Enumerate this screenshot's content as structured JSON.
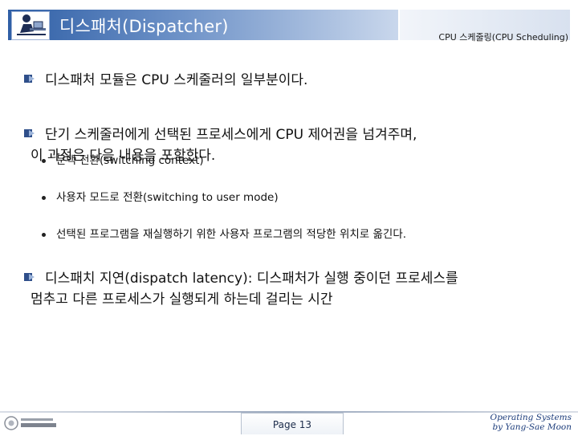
{
  "header": {
    "title": "디스패처(Dispatcher)",
    "subtitle": "CPU 스케줄링(CPU Scheduling)",
    "logo_icon": "person-at-desk-icon"
  },
  "body": {
    "bullets": [
      {
        "lines": [
          "디스패처 모듈은 CPU 스케줄러의 일부분이다."
        ]
      },
      {
        "lines": [
          "단기 스케줄러에게 선택된 프로세스에게 CPU 제어권을 넘겨주며,",
          "이 과정은 다음 내용을 포함한다."
        ]
      },
      {
        "lines": [
          "디스패치 지연(dispatch latency): 디스패처가 실행 중이던  프로세스를",
          "멈추고 다른 프로세스가 실행되게 하는데 걸리는 시간"
        ]
      }
    ],
    "sub_items": [
      "문맥 전환(switching context)",
      "사용자 모드로 전환(switching to user mode)",
      "선택된 프로그램을 재실행하기 위한 사용자 프로그램의 적당한 위치로 옮긴다."
    ],
    "bullet_icon": "arrow-bullet-icon"
  },
  "footer": {
    "page_label": "Page 13",
    "credit_line1": "Operating Systems",
    "credit_line2": "by Yang-Sae Moon",
    "logo_icon": "university-logo-icon"
  },
  "colors": {
    "title_band": "#2f5fa6",
    "title_text": "#ffffff",
    "credit_text": "#1b3b7a"
  }
}
